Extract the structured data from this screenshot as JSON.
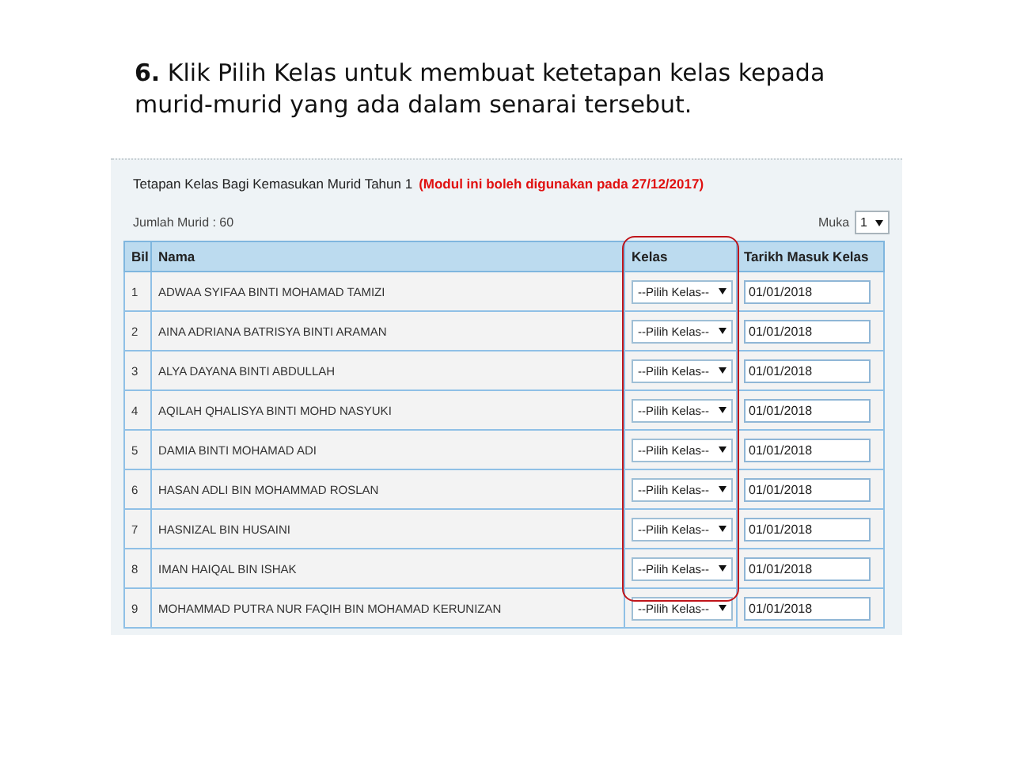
{
  "instruction": "**6.** Klik Pilih Kelas untuk membuat ketetapan kelas kepada murid-murid yang ada dalam senarai tersebut.",
  "panel": {
    "title": "Tetapan Kelas Bagi Kemasukan Murid Tahun 1",
    "notice": "(Modul ini boleh digunakan pada 27/12/2017)",
    "count": "Jumlah Murid : 60",
    "page_label": "Muka",
    "page_value": "1"
  },
  "table": {
    "columns": [
      "Bil",
      "Nama",
      "Kelas",
      "Tarikh Masuk Kelas"
    ],
    "rows": [
      {
        "bil": "1",
        "nama": "ADWAA SYIFAA BINTI MOHAMAD TAMIZI",
        "kelas": "--Pilih Kelas--",
        "tarikh": "01/01/2018"
      },
      {
        "bil": "2",
        "nama": "AINA ADRIANA BATRISYA BINTI ARAMAN",
        "kelas": "--Pilih Kelas--",
        "tarikh": "01/01/2018"
      },
      {
        "bil": "3",
        "nama": "ALYA DAYANA BINTI ABDULLAH",
        "kelas": "--Pilih Kelas--",
        "tarikh": "01/01/2018"
      },
      {
        "bil": "4",
        "nama": "AQILAH QHALISYA BINTI MOHD NASYUKI",
        "kelas": "--Pilih Kelas--",
        "tarikh": "01/01/2018"
      },
      {
        "bil": "5",
        "nama": "DAMIA BINTI MOHAMAD ADI",
        "kelas": "--Pilih Kelas--",
        "tarikh": "01/01/2018"
      },
      {
        "bil": "6",
        "nama": "HASAN ADLI BIN MOHAMMAD ROSLAN",
        "kelas": "--Pilih Kelas--",
        "tarikh": "01/01/2018"
      },
      {
        "bil": "7",
        "nama": "HASNIZAL BIN HUSAINI",
        "kelas": "--Pilih Kelas--",
        "tarikh": "01/01/2018"
      },
      {
        "bil": "8",
        "nama": "IMAN HAIQAL BIN ISHAK",
        "kelas": "--Pilih Kelas--",
        "tarikh": "01/01/2018"
      },
      {
        "bil": "9",
        "nama": "MOHAMMAD PUTRA NUR FAQIH BIN MOHAMAD KERUNIZAN",
        "kelas": "--Pilih Kelas--",
        "tarikh": "01/01/2018"
      }
    ]
  }
}
